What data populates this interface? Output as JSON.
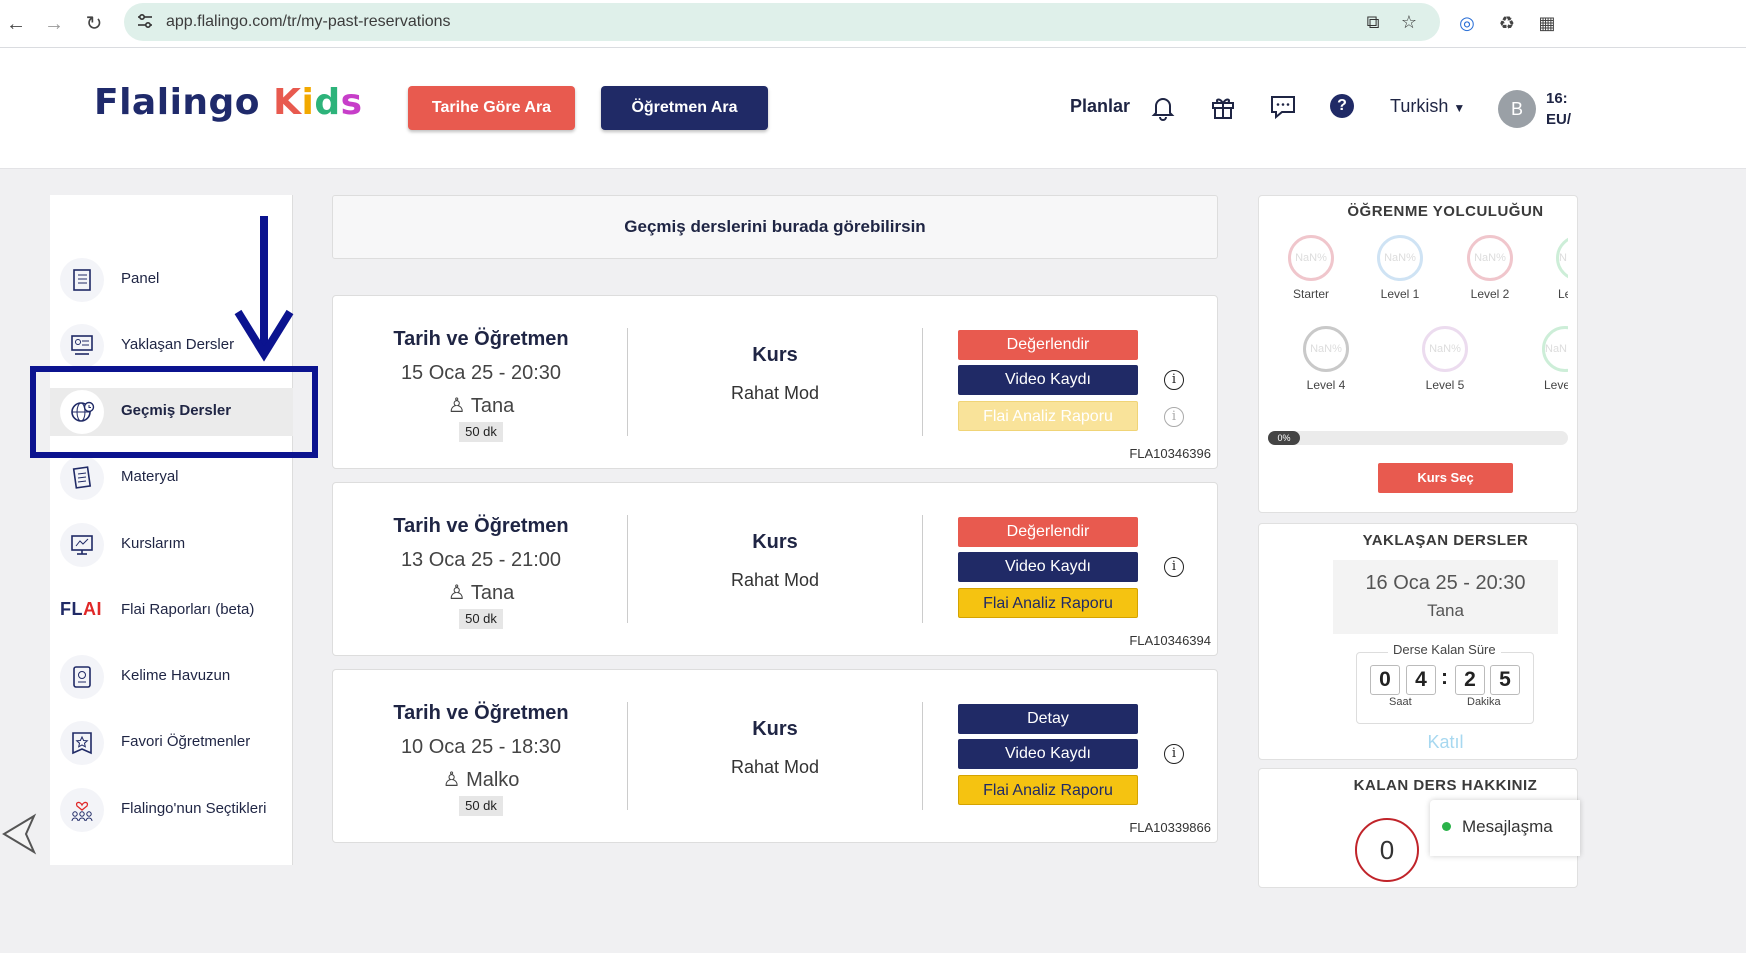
{
  "browser": {
    "url": "app.flalingo.com/tr/my-past-reservations"
  },
  "header": {
    "logo_main": "Flalingo",
    "logo_kids": [
      "K",
      "i",
      "d",
      "s"
    ],
    "btn_date": "Tarihe Göre Ara",
    "btn_teacher": "Öğretmen Ara",
    "plans": "Planlar",
    "language": "Turkish",
    "avatar_initial": "B",
    "time_partial": "16:",
    "tz_partial": "EU/"
  },
  "sidebar": {
    "items": [
      {
        "label": "Panel"
      },
      {
        "label": "Yaklaşan Dersler"
      },
      {
        "label": "Geçmiş Dersler"
      },
      {
        "label": "Materyal"
      },
      {
        "label": "Kurslarım"
      },
      {
        "label": "Flai Raporları (beta)"
      },
      {
        "label": "Kelime Havuzun"
      },
      {
        "label": "Favori Öğretmenler"
      },
      {
        "label": "Flalingo'nun Seçtikleri"
      }
    ],
    "flai_logo": "FL",
    "flai_logo_red": "AI"
  },
  "main": {
    "banner": "Geçmiş derslerini burada görebilirsin",
    "cards": [
      {
        "col_title": "Tarih ve Öğretmen",
        "date": "15 Oca 25 - 20:30",
        "teacher": "Tana",
        "duration": "50 dk",
        "kurs_title": "Kurs",
        "mode": "Rahat Mod",
        "btn1": "Değerlendir",
        "btn2": "Video Kaydı",
        "btn3": "Flai Analiz Raporu",
        "code": "FLA10346396"
      },
      {
        "col_title": "Tarih ve Öğretmen",
        "date": "13 Oca 25 - 21:00",
        "teacher": "Tana",
        "duration": "50 dk",
        "kurs_title": "Kurs",
        "mode": "Rahat Mod",
        "btn1": "Değerlendir",
        "btn2": "Video Kaydı",
        "btn3": "Flai Analiz Raporu",
        "code": "FLA10346394"
      },
      {
        "col_title": "Tarih ve Öğretmen",
        "date": "10 Oca 25 - 18:30",
        "teacher": "Malko",
        "duration": "50 dk",
        "kurs_title": "Kurs",
        "mode": "Rahat Mod",
        "btn1": "Detay",
        "btn2": "Video Kaydı",
        "btn3": "Flai Analiz Raporu",
        "code": "FLA10339866"
      }
    ],
    "info_glyph": "i"
  },
  "right": {
    "journey_title": "ÖĞRENME YOLCULUĞUN",
    "levels": [
      {
        "name": "Starter",
        "value": "NaN%"
      },
      {
        "name": "Level 1",
        "value": "NaN%"
      },
      {
        "name": "Level 2",
        "value": "NaN%"
      },
      {
        "name": "Le",
        "value": "N"
      },
      {
        "name": "Level 4",
        "value": "NaN%"
      },
      {
        "name": "Level 5",
        "value": "NaN%"
      },
      {
        "name": "Leve",
        "value": "NaN"
      }
    ],
    "progress_label": "0%",
    "progress_value": 0,
    "kurs_sec": "Kurs Seç",
    "upcoming_title": "YAKLAŞAN DERSLER",
    "upcoming_date": "16 Oca 25 - 20:30",
    "upcoming_teacher": "Tana",
    "countdown_label": "Derse Kalan Süre",
    "digits": [
      "0",
      "4",
      "2",
      "5"
    ],
    "colon": ":",
    "unit_hours": "Saat",
    "unit_minutes": "Dakika",
    "join": "Katıl",
    "remaining_title": "KALAN DERS HAKKINIZ",
    "remaining_value": "0",
    "chat": "Mesajlaşma"
  },
  "colors": {
    "navy": "#202a66",
    "red": "#e85a4f",
    "yellow": "#f5c311",
    "highlight": "#0b138f"
  }
}
